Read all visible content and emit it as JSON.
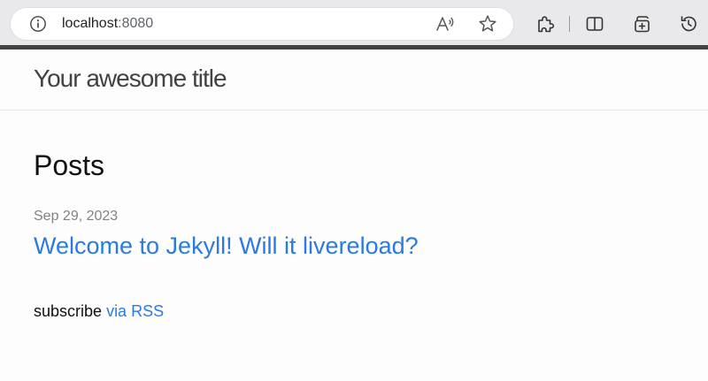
{
  "browser": {
    "url_host": "localhost",
    "url_port": ":8080",
    "icons": [
      "info-icon",
      "read-aloud-icon",
      "favorite-icon",
      "extensions-icon",
      "split-screen-icon",
      "collections-icon",
      "history-icon"
    ]
  },
  "site": {
    "title": "Your awesome title"
  },
  "main": {
    "heading": "Posts",
    "posts": [
      {
        "date": "Sep 29, 2023",
        "title": "Welcome to Jekyll! Will it livereload?"
      }
    ],
    "rss": {
      "prefix": "subscribe",
      "link_text": "via RSS"
    }
  },
  "colors": {
    "link": "#2a7ae2",
    "text": "#111111",
    "meta": "#828282",
    "header_border": "#424242",
    "toolbar": "#e9e9eb"
  }
}
